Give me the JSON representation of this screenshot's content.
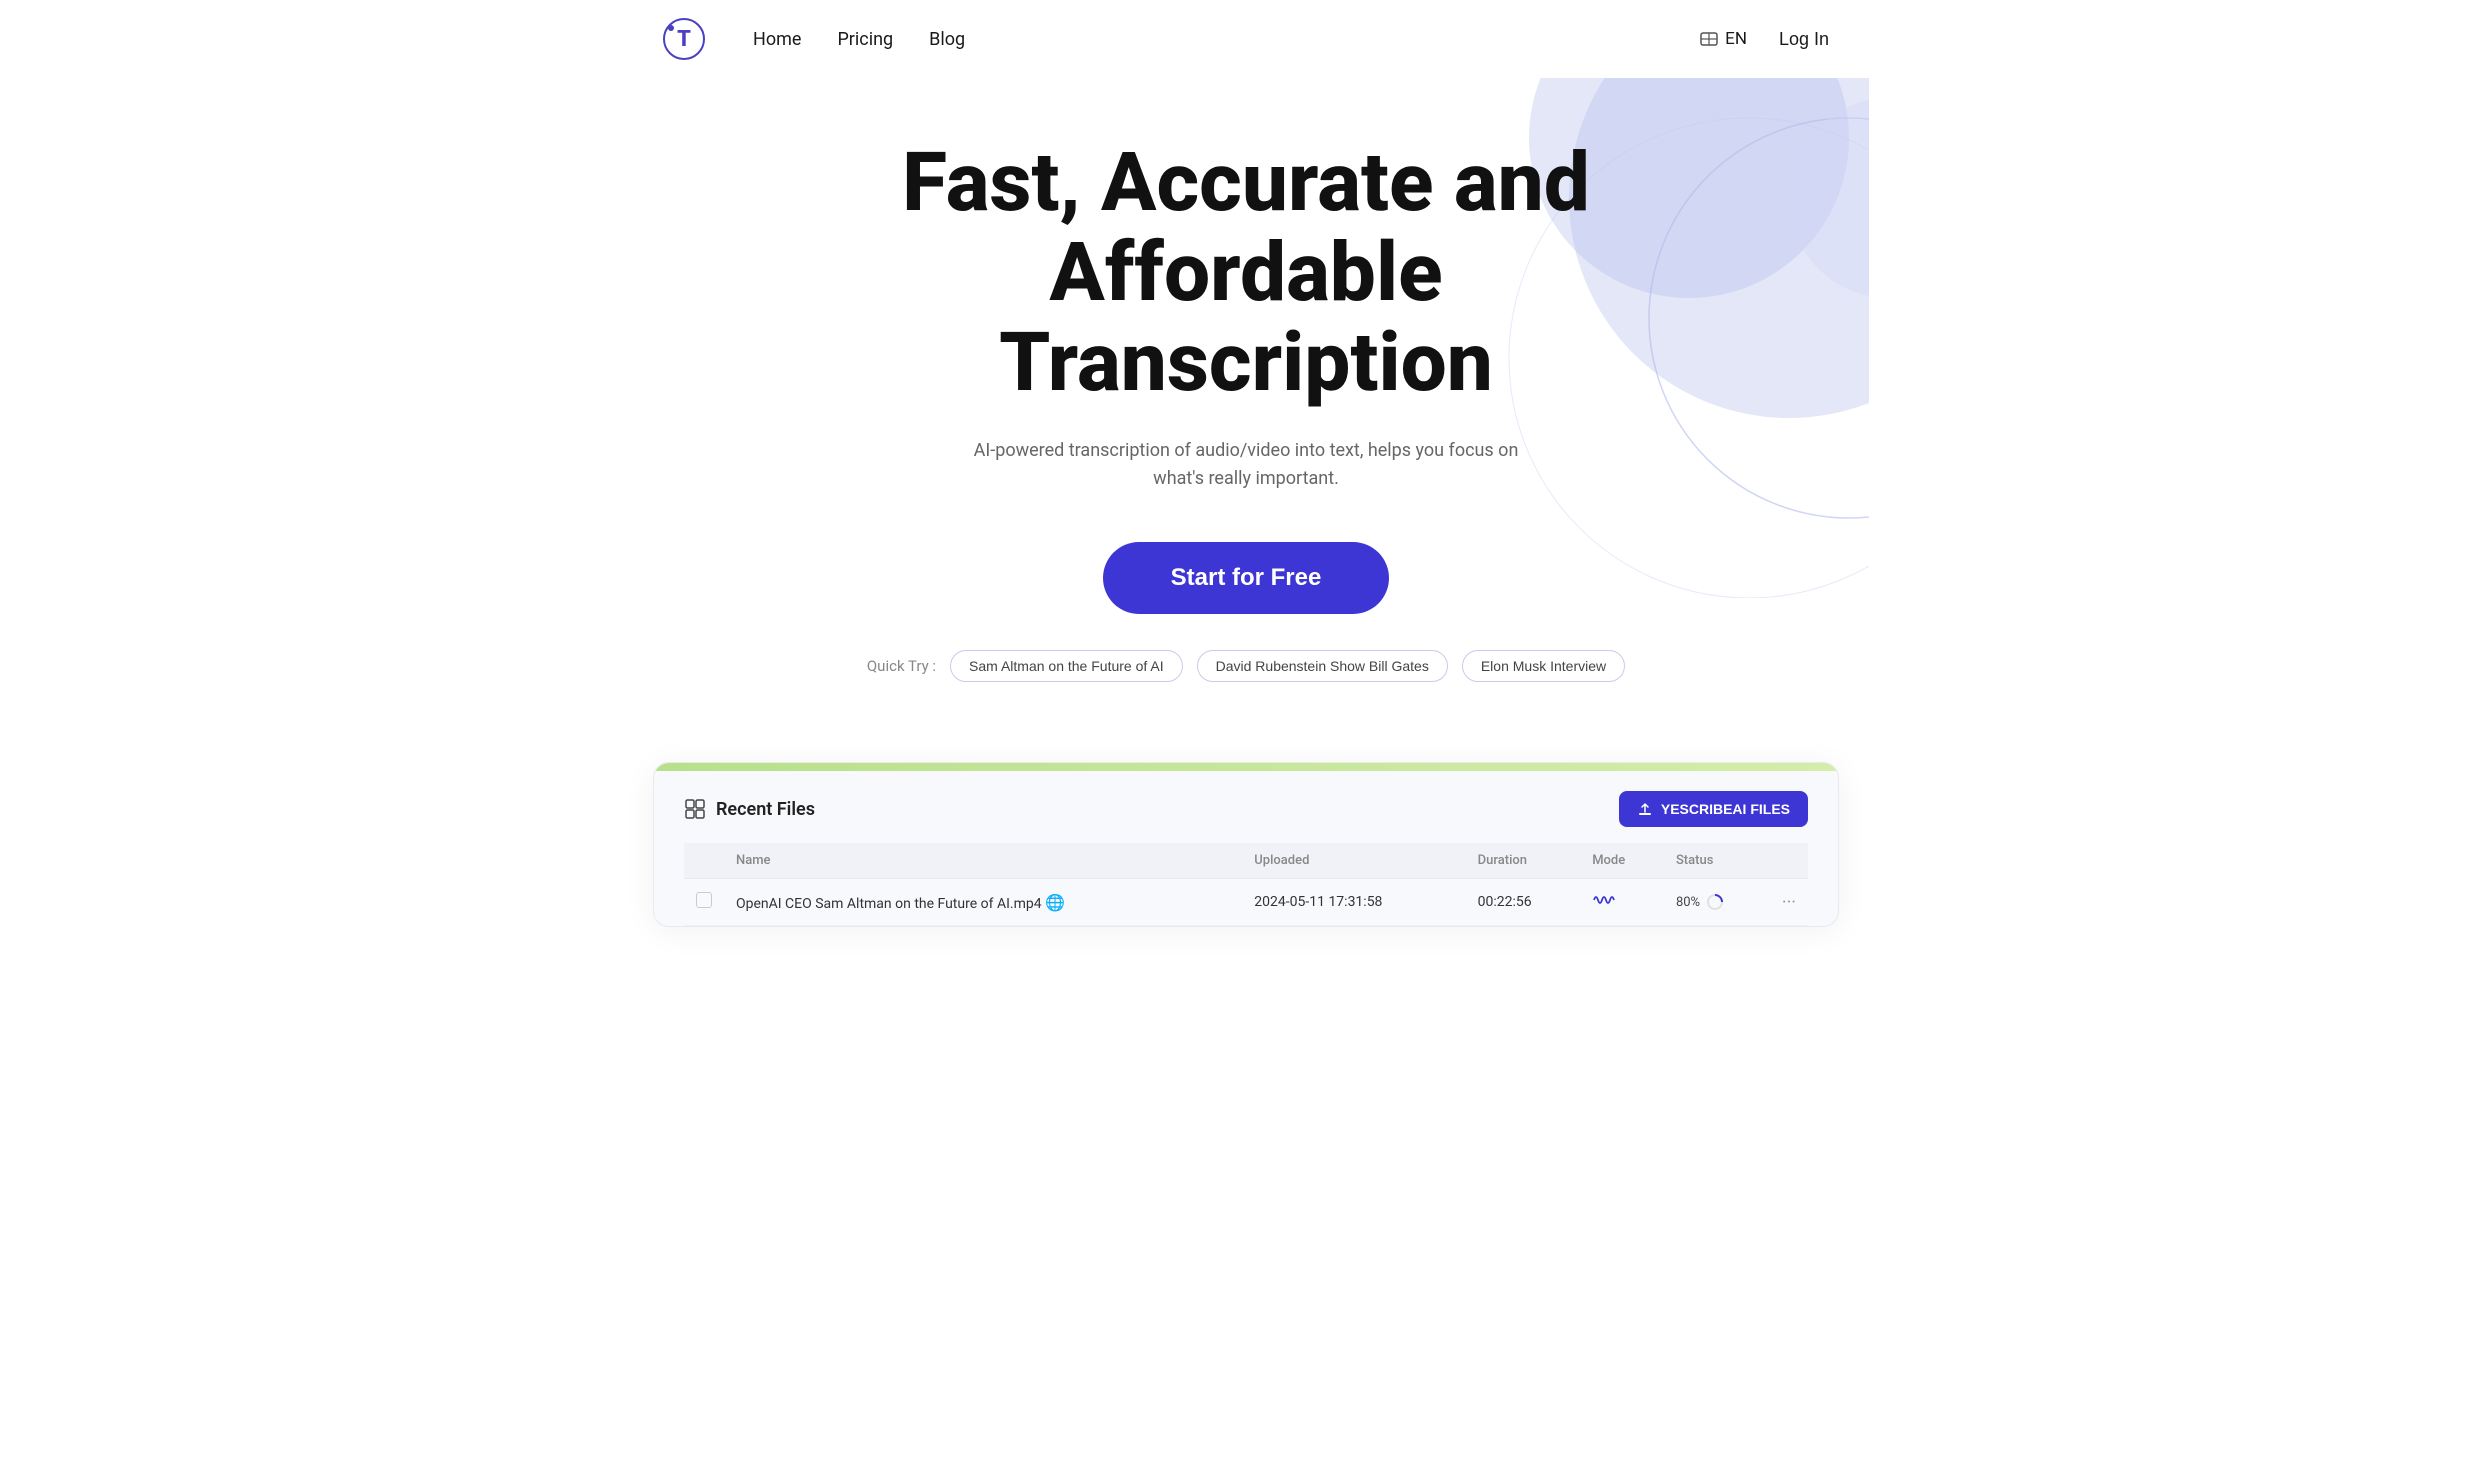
{
  "brand": {
    "logo_text": "T",
    "logo_color": "#4A3FC5"
  },
  "navbar": {
    "links": [
      {
        "label": "Home",
        "id": "home"
      },
      {
        "label": "Pricing",
        "id": "pricing"
      },
      {
        "label": "Blog",
        "id": "blog"
      }
    ],
    "lang": "EN",
    "login_label": "Log In"
  },
  "hero": {
    "title_line1": "Fast, Accurate and",
    "title_line2": "Affordable Transcription",
    "subtitle": "AI-powered transcription of audio/video into text, helps you focus on what's really important.",
    "cta_label": "Start for Free",
    "quick_try_label": "Quick Try :",
    "quick_try_chips": [
      "Sam Altman on the Future of AI",
      "David Rubenstein Show Bill Gates",
      "Elon Musk Interview"
    ]
  },
  "dashboard": {
    "top_bar_color": "#b8e08a",
    "recent_files_label": "Recent Files",
    "upload_button_label": "YESCRIBEAI FILES",
    "table_headers": [
      "Name",
      "Uploaded",
      "Duration",
      "Mode",
      "Status"
    ],
    "rows": [
      {
        "name": "OpenAI CEO Sam Altman on the Future of AI.mp4",
        "globe": true,
        "uploaded": "2024-05-11 17:31:58",
        "duration": "00:22:56",
        "mode": "wave",
        "status": "80%",
        "loading": true
      }
    ]
  }
}
